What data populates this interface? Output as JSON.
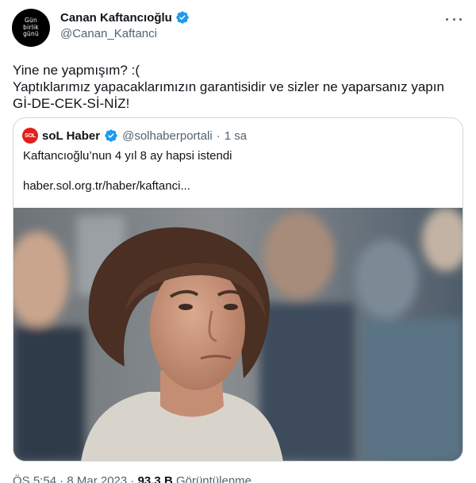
{
  "author": {
    "name": "Canan Kaftancıoğlu",
    "handle": "@Canan_Kaftanci",
    "avatar_lines": [
      "Gün",
      "birlik",
      "günü"
    ],
    "avatar_bg": "#000000",
    "verified_icon": "verified-badge-icon",
    "verified_color": "#1d9bf0"
  },
  "more_icon": "more-dots-icon",
  "tweet": {
    "lines": [
      "Yine ne yapmışım? :(",
      "Yaptıklarımız yapacaklarımızın garantisidir ve sizler ne yaparsanız yapın",
      "Gİ-DE-CEK-Sİ-NİZ!"
    ]
  },
  "quote": {
    "avatar_text": "SOL",
    "avatar_color": "#e0201a",
    "name": "soL Haber",
    "handle": "@solhaberportali",
    "dot": "·",
    "time": "1 sa",
    "text": "Kaftancıoğlu’nun 4 yıl 8 ay hapsi istendi",
    "link": "haber.sol.org.tr/haber/kaftanci...",
    "image": "portrait-photo"
  },
  "meta": {
    "time": "ÖS 5:54 · 8 Mar 2023 ·",
    "views": "93,3 B",
    "views_label": "Görüntülenme"
  }
}
